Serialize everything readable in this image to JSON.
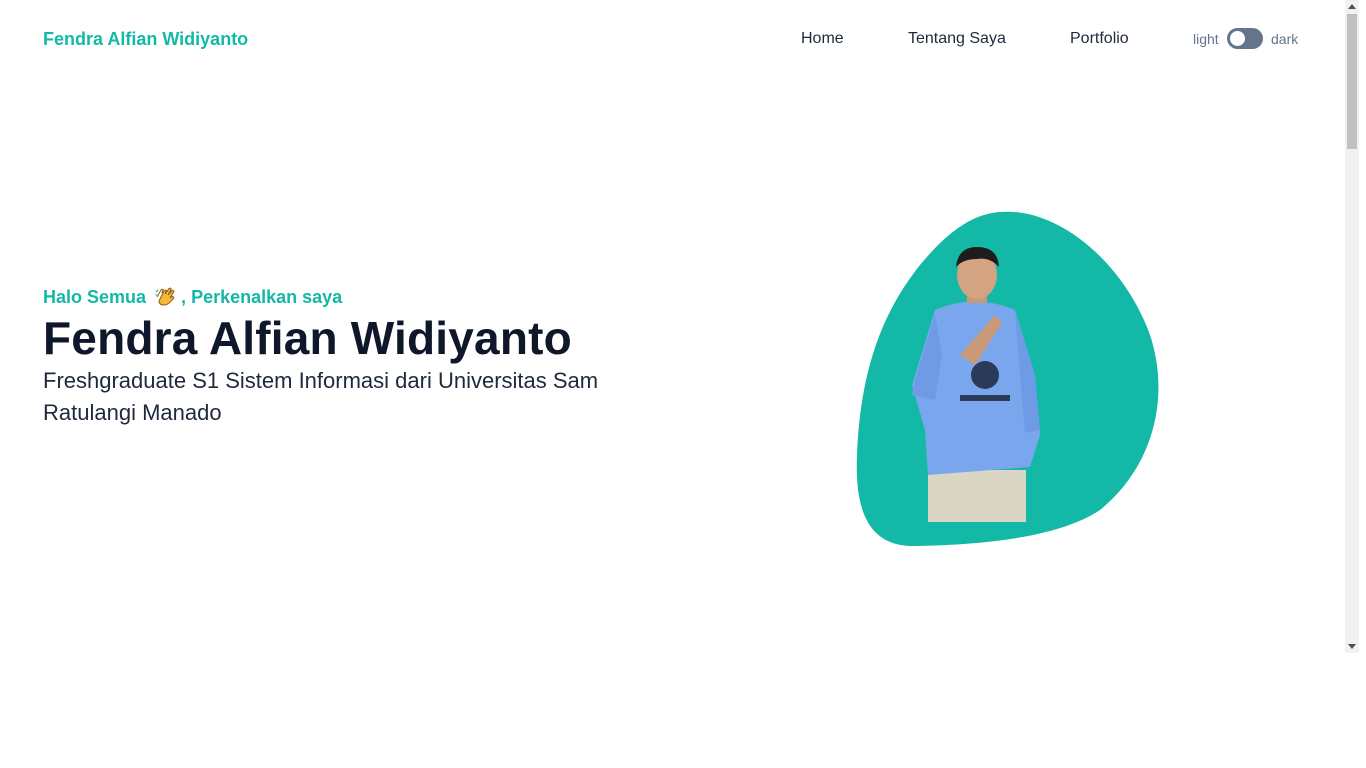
{
  "header": {
    "brand": "Fendra Alfian Widiyanto",
    "nav": [
      {
        "label": "Home"
      },
      {
        "label": "Tentang Saya"
      },
      {
        "label": "Portfolio"
      }
    ],
    "theme_toggle": {
      "light_label": "light",
      "dark_label": "dark",
      "state": "light"
    }
  },
  "hero": {
    "greeting_start": "Halo Semua",
    "greeting_emoji_icon": "clapping-hands-icon",
    "greeting_comma": ",",
    "greeting_end": "Perkenalkan saya",
    "name": "Fendra Alfian Widiyanto",
    "description": "Freshgraduate S1 Sistem Informasi dari Universitas Sam Ratulangi Manado",
    "photo_alt": "Fendra Alfian Widiyanto"
  },
  "colors": {
    "accent": "#14b8a6",
    "text_dark": "#0f172a",
    "toggle": "#64748b"
  }
}
